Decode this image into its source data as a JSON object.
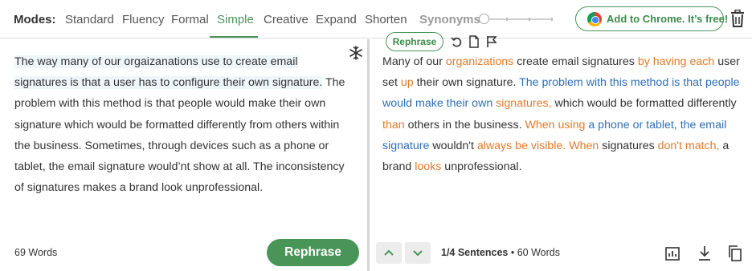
{
  "toolbar": {
    "modes_label": "Modes:",
    "modes": [
      "Standard",
      "Fluency",
      "Formal",
      "Simple",
      "Creative",
      "Expand",
      "Shorten"
    ],
    "active_mode": "Simple",
    "synonyms_label": "Synonyms:",
    "synonyms_level": 0,
    "chrome_button_label": "Add to Chrome. It’s free!",
    "accent_color": "#499557"
  },
  "input": {
    "segments": [
      {
        "text": "The way many of our orgaizanations use to create email signatures is that a user has to configure their own signature.",
        "highlight": true
      },
      {
        "text": " The problem with this method is that people would make their own signature which would be formatted differently from others within the business. Sometimes, through devices such as a phone or tablet, the email signature would’nt show at all. The inconsistency of signatures makes a brand look unprofessional.",
        "highlight": false
      }
    ],
    "word_count": "69 Words",
    "rephrase_button": "Rephrase"
  },
  "output": {
    "rephrase_pill": "Rephrase",
    "segments": [
      {
        "text": "Many of our ",
        "type": "plain"
      },
      {
        "text": "organizations",
        "type": "changed"
      },
      {
        "text": " create email signatures ",
        "type": "plain"
      },
      {
        "text": "by having each",
        "type": "changed"
      },
      {
        "text": " user set ",
        "type": "plain"
      },
      {
        "text": "up",
        "type": "changed"
      },
      {
        "text": " their own signature. ",
        "type": "plain"
      },
      {
        "text": "The problem with this method is that people would make their own",
        "type": "structure"
      },
      {
        "text": " ",
        "type": "plain"
      },
      {
        "text": "signatures,",
        "type": "changed"
      },
      {
        "text": " which would be formatted differently ",
        "type": "plain"
      },
      {
        "text": "than",
        "type": "changed"
      },
      {
        "text": " others in the business. ",
        "type": "plain"
      },
      {
        "text": "When using",
        "type": "changed"
      },
      {
        "text": " ",
        "type": "plain"
      },
      {
        "text": "a phone or tablet, the email signature",
        "type": "structure"
      },
      {
        "text": " wouldn't ",
        "type": "plain"
      },
      {
        "text": "always be visible.",
        "type": "changed"
      },
      {
        "text": " ",
        "type": "plain"
      },
      {
        "text": "When",
        "type": "changed"
      },
      {
        "text": " signatures ",
        "type": "plain"
      },
      {
        "text": "don't match,",
        "type": "changed"
      },
      {
        "text": " a brand ",
        "type": "plain"
      },
      {
        "text": "looks",
        "type": "changed"
      },
      {
        "text": " unprofessional.",
        "type": "plain"
      }
    ],
    "sentence_position": "1/4 Sentences",
    "word_count": "60 Words",
    "colors": {
      "changed": "#e07a2a",
      "structure": "#2d6fb5"
    }
  },
  "icons": [
    "chrome-icon",
    "trash-icon",
    "freeze-icon",
    "undo-icon",
    "copy-doc-icon",
    "flag-icon",
    "chevron-up-icon",
    "chevron-down-icon",
    "stats-icon",
    "download-icon",
    "copy-icon"
  ]
}
